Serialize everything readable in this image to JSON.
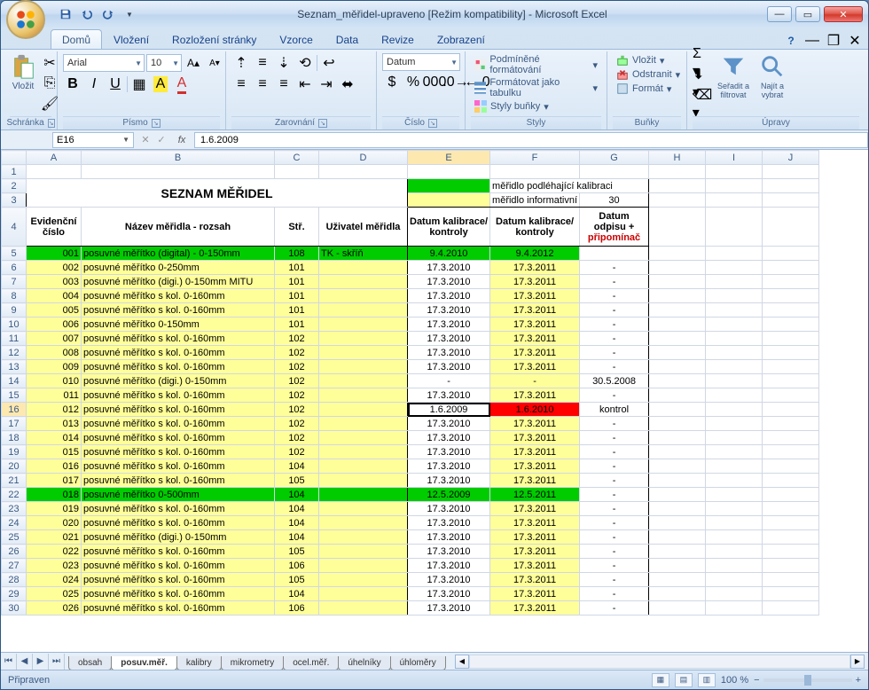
{
  "window": {
    "title": "Seznam_měřidel-upraveno  [Režim kompatibility] - Microsoft Excel"
  },
  "tabs": [
    "Domů",
    "Vložení",
    "Rozložení stránky",
    "Vzorce",
    "Data",
    "Revize",
    "Zobrazení"
  ],
  "active_tab": "Domů",
  "ribbon": {
    "clipboard": {
      "paste": "Vložit",
      "label": "Schránka"
    },
    "font": {
      "name": "Arial",
      "size": "10",
      "label": "Písmo"
    },
    "alignment": {
      "label": "Zarovnání"
    },
    "number": {
      "format": "Datum",
      "label": "Číslo"
    },
    "styles": {
      "condfmt": "Podmíněné formátování",
      "astable": "Formátovat jako tabulku",
      "cellstyles": "Styly buňky",
      "label": "Styly"
    },
    "cells": {
      "insert": "Vložit",
      "delete": "Odstranit",
      "format": "Formát",
      "label": "Buňky"
    },
    "editing": {
      "sortfilter": "Seřadit a filtrovat",
      "findselect": "Najít a vybrat",
      "label": "Úpravy"
    }
  },
  "formula": {
    "cellref": "E16",
    "value": "1.6.2009"
  },
  "columns": [
    "A",
    "B",
    "C",
    "D",
    "E",
    "F",
    "G",
    "H",
    "I",
    "J"
  ],
  "header_block": {
    "title": "SEZNAM MĚŘIDEL",
    "legend1_text": "měřidlo podléhající kalibraci",
    "legend2_text": "měřidlo informativní",
    "g3_value": "30",
    "headers": {
      "A": "Evidenční číslo",
      "B": "Název měřidla - rozsah",
      "C": "Stř.",
      "D": "Uživatel měřidla",
      "E": "Datum kalibrace/ kontroly",
      "F": "Datum kalibrace/ kontroly",
      "G": "Datum odpisu + připomínač"
    }
  },
  "rows": [
    {
      "r": 5,
      "a": "001",
      "b": "posuvné měřítko (digital) - 0-150mm",
      "c": "108",
      "d": "TK - skříň",
      "e": "9.4.2010",
      "f": "9.4.2012",
      "g": "",
      "cls": "green"
    },
    {
      "r": 6,
      "a": "002",
      "b": "posuvné měřítko 0-250mm",
      "c": "101",
      "d": "",
      "e": "17.3.2010",
      "f": "17.3.2011",
      "g": "-",
      "cls": "yellow"
    },
    {
      "r": 7,
      "a": "003",
      "b": "posuvné měřítko (digi.) 0-150mm MITU",
      "c": "101",
      "d": "",
      "e": "17.3.2010",
      "f": "17.3.2011",
      "g": "-",
      "cls": "yellow"
    },
    {
      "r": 8,
      "a": "004",
      "b": "posuvné měřítko s kol. 0-160mm",
      "c": "101",
      "d": "",
      "e": "17.3.2010",
      "f": "17.3.2011",
      "g": "-",
      "cls": "yellow"
    },
    {
      "r": 9,
      "a": "005",
      "b": "posuvné měřítko s kol. 0-160mm",
      "c": "101",
      "d": "",
      "e": "17.3.2010",
      "f": "17.3.2011",
      "g": "-",
      "cls": "yellow"
    },
    {
      "r": 10,
      "a": "006",
      "b": "posuvné měřítko 0-150mm",
      "c": "101",
      "d": "",
      "e": "17.3.2010",
      "f": "17.3.2011",
      "g": "-",
      "cls": "yellow"
    },
    {
      "r": 11,
      "a": "007",
      "b": "posuvné měřítko s kol. 0-160mm",
      "c": "102",
      "d": "",
      "e": "17.3.2010",
      "f": "17.3.2011",
      "g": "-",
      "cls": "yellow"
    },
    {
      "r": 12,
      "a": "008",
      "b": "posuvné měřítko s kol. 0-160mm",
      "c": "102",
      "d": "",
      "e": "17.3.2010",
      "f": "17.3.2011",
      "g": "-",
      "cls": "yellow"
    },
    {
      "r": 13,
      "a": "009",
      "b": "posuvné měřítko s kol. 0-160mm",
      "c": "102",
      "d": "",
      "e": "17.3.2010",
      "f": "17.3.2011",
      "g": "-",
      "cls": "yellow"
    },
    {
      "r": 14,
      "a": "010",
      "b": "posuvné měřítko (digi.) 0-150mm",
      "c": "102",
      "d": "",
      "e": "-",
      "f": "-",
      "g": "30.5.2008",
      "cls": "yellow"
    },
    {
      "r": 15,
      "a": "011",
      "b": "posuvné měřítko s kol. 0-160mm",
      "c": "102",
      "d": "",
      "e": "17.3.2010",
      "f": "17.3.2011",
      "g": "-",
      "cls": "yellow"
    },
    {
      "r": 16,
      "a": "012",
      "b": "posuvné měřítko s kol. 0-160mm",
      "c": "102",
      "d": "",
      "e": "1.6.2009",
      "f": "1.6.2010",
      "g": "kontrol",
      "cls": "yellow",
      "selected": true,
      "fred": true
    },
    {
      "r": 17,
      "a": "013",
      "b": "posuvné měřítko s kol. 0-160mm",
      "c": "102",
      "d": "",
      "e": "17.3.2010",
      "f": "17.3.2011",
      "g": "-",
      "cls": "yellow"
    },
    {
      "r": 18,
      "a": "014",
      "b": "posuvné měřítko s kol. 0-160mm",
      "c": "102",
      "d": "",
      "e": "17.3.2010",
      "f": "17.3.2011",
      "g": "-",
      "cls": "yellow"
    },
    {
      "r": 19,
      "a": "015",
      "b": "posuvné měřítko s kol. 0-160mm",
      "c": "102",
      "d": "",
      "e": "17.3.2010",
      "f": "17.3.2011",
      "g": "-",
      "cls": "yellow"
    },
    {
      "r": 20,
      "a": "016",
      "b": "posuvné měřítko s kol. 0-160mm",
      "c": "104",
      "d": "",
      "e": "17.3.2010",
      "f": "17.3.2011",
      "g": "-",
      "cls": "yellow"
    },
    {
      "r": 21,
      "a": "017",
      "b": "posuvné měřítko s kol. 0-160mm",
      "c": "105",
      "d": "",
      "e": "17.3.2010",
      "f": "17.3.2011",
      "g": "-",
      "cls": "yellow"
    },
    {
      "r": 22,
      "a": "018",
      "b": "posuvné měřítko 0-500mm",
      "c": "104",
      "d": "",
      "e": "12.5.2009",
      "f": "12.5.2011",
      "g": "-",
      "cls": "green"
    },
    {
      "r": 23,
      "a": "019",
      "b": "posuvné měřítko s kol. 0-160mm",
      "c": "104",
      "d": "",
      "e": "17.3.2010",
      "f": "17.3.2011",
      "g": "-",
      "cls": "yellow"
    },
    {
      "r": 24,
      "a": "020",
      "b": "posuvné měřítko s kol. 0-160mm",
      "c": "104",
      "d": "",
      "e": "17.3.2010",
      "f": "17.3.2011",
      "g": "-",
      "cls": "yellow"
    },
    {
      "r": 25,
      "a": "021",
      "b": "posuvné měřítko (digi.) 0-150mm",
      "c": "104",
      "d": "",
      "e": "17.3.2010",
      "f": "17.3.2011",
      "g": "-",
      "cls": "yellow"
    },
    {
      "r": 26,
      "a": "022",
      "b": "posuvné měřítko s kol. 0-160mm",
      "c": "105",
      "d": "",
      "e": "17.3.2010",
      "f": "17.3.2011",
      "g": "-",
      "cls": "yellow"
    },
    {
      "r": 27,
      "a": "023",
      "b": "posuvné měřítko s kol. 0-160mm",
      "c": "106",
      "d": "",
      "e": "17.3.2010",
      "f": "17.3.2011",
      "g": "-",
      "cls": "yellow"
    },
    {
      "r": 28,
      "a": "024",
      "b": "posuvné měřítko s kol. 0-160mm",
      "c": "105",
      "d": "",
      "e": "17.3.2010",
      "f": "17.3.2011",
      "g": "-",
      "cls": "yellow"
    },
    {
      "r": 29,
      "a": "025",
      "b": "posuvné měřítko s kol. 0-160mm",
      "c": "104",
      "d": "",
      "e": "17.3.2010",
      "f": "17.3.2011",
      "g": "-",
      "cls": "yellow"
    },
    {
      "r": 30,
      "a": "026",
      "b": "posuvné měřítko s kol. 0-160mm",
      "c": "106",
      "d": "",
      "e": "17.3.2010",
      "f": "17.3.2011",
      "g": "-",
      "cls": "yellow"
    }
  ],
  "sheets": [
    "obsah",
    "posuv.měř.",
    "kalibry",
    "mikrometry",
    "ocel.měř.",
    "úhelníky",
    "úhloměry"
  ],
  "active_sheet": "posuv.měř.",
  "status": {
    "text": "Připraven",
    "zoom": "100 %"
  }
}
